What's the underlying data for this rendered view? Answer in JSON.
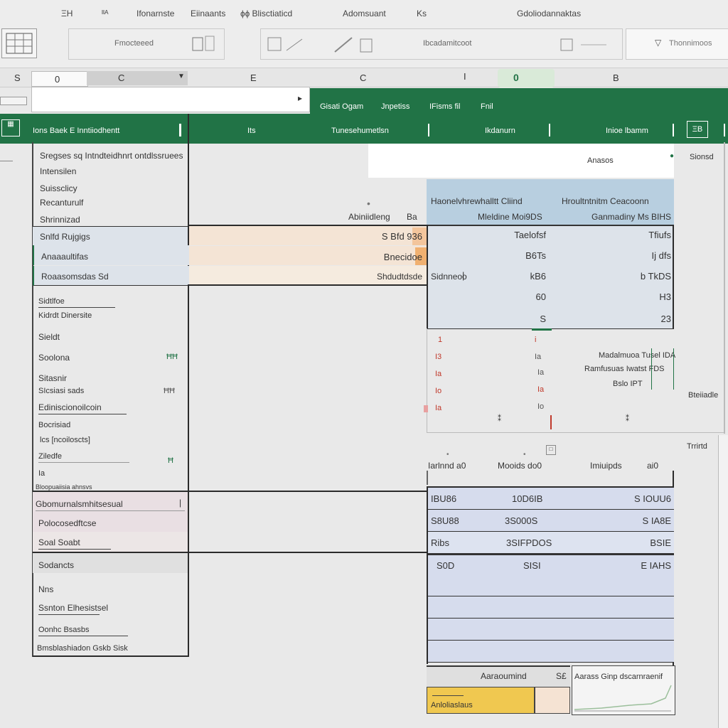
{
  "ribbon": {
    "tabs": [
      "ΞΗ",
      "ᴵᴵᴬ",
      "Ifonarnste",
      "Eiinaants",
      "ɸɸ Blisctiaticd",
      "Adomsuant",
      "Ks",
      "Gdoliodannaktas"
    ],
    "group_labels": [
      "Fmocteeed",
      "Ibcadamitcoot",
      "Thonnimoos"
    ]
  },
  "formula_bar": {
    "name_box": "0",
    "col_letter": "C",
    "input_value": ""
  },
  "col_headers": [
    "S",
    "0",
    "C",
    "E",
    "C",
    "I",
    "0",
    "B"
  ],
  "green_band": {
    "menu_items": [
      "Gisati Ogam",
      "Jnpetiss",
      "IFisms fil",
      "Fnil"
    ],
    "headers": [
      "Ions Baek E Inntiiodhentt",
      "Its",
      "Tunesehumetlsn",
      "Ikdanurn",
      "Inioe lbamm"
    ],
    "right_icon": "ΞΒ"
  },
  "left_panel": {
    "notes": [
      "Sregses sq Intndteidhnrt ontdlssruees",
      "Intensilen",
      "Suissclicy",
      "Recanturulf",
      "Shrinnizad"
    ],
    "highlighted_rows": [
      "Snlfd Rujgigs",
      "Anaaaultifas",
      "Roaasomsdas Sd"
    ],
    "items": [
      "Sidtlfoe",
      "Kidrdt Dinersite",
      "Sieldt",
      "Soolona",
      "Sitasnir",
      "SIcsiasi sads",
      "Ediniscionoilcoin",
      "Bocrisiad",
      "lcs [ncoiloscts]",
      "Ziledfe",
      "Ia",
      "Bloopuaiisia ahnsvs"
    ],
    "item_marks": [
      "ĦĦ",
      "ĦĦ",
      "Ħ"
    ],
    "section2_rows": [
      "Gbomurnalsmhitsesual",
      "Polocosedftcse",
      "Soal Soabt"
    ],
    "section3": [
      "Sodancts",
      "Nns",
      "Ssnton Elhesistsel",
      "Oonhc Bsasbs",
      "Bmsblashiadon Gskb Sisk"
    ]
  },
  "middle_panel": {
    "hint_label": "Abiniidleng",
    "hint_code": "Ba",
    "values": [
      "S Bfd 936",
      "Bnecidoe",
      "Shdudtdsde"
    ],
    "right_label": "Sidnneoo"
  },
  "right_table": {
    "white_label": "Anasos",
    "side_label": "Sionsd",
    "col_a_header": [
      "Haonelvhrewhalltt Cliind",
      "Mleldine Moi9DS"
    ],
    "col_b_header": [
      "Hroultntnitm Ceacoonn",
      "Ganmadiny Ms BIHS"
    ],
    "rows": [
      [
        "Taelofsf",
        "Tfiufs"
      ],
      [
        "B6Ts",
        "Ij dfs"
      ],
      [
        "kB6",
        "b TkDS"
      ],
      [
        "60",
        "H3"
      ],
      [
        "S",
        "23"
      ]
    ],
    "scatter_left": [
      "1",
      "I3",
      "Ia",
      "Io",
      "Ia"
    ],
    "scatter_mid": [
      "i",
      "Ia",
      "Ia",
      "Ia",
      "Io"
    ],
    "legend": [
      "Madalmuoa Tusel IDA",
      "Ramfusuas Iwatst FDS",
      "Bslo IPT"
    ],
    "outer_label": "Bteiiadle",
    "outer_label2": "Trrirtd"
  },
  "bottom_table": {
    "headers": [
      "Iarlnnd a0",
      "Mooids do0",
      "Imiuipds",
      "ai0"
    ],
    "rows": [
      [
        "IBU86",
        "10D6IB",
        "S IOUU6"
      ],
      [
        "S8U88",
        "3S000S",
        "S IA8E"
      ],
      [
        "Ribs",
        "3SIFPDOS",
        "BSIE"
      ],
      [
        "S0D",
        "SISI",
        "E IAHS"
      ]
    ]
  },
  "footer": {
    "label": "Aaraoumind",
    "code": "S£",
    "right_label": "Aarass Ginp dscarnraenif",
    "yellow_label": "Anloliaslaus"
  }
}
